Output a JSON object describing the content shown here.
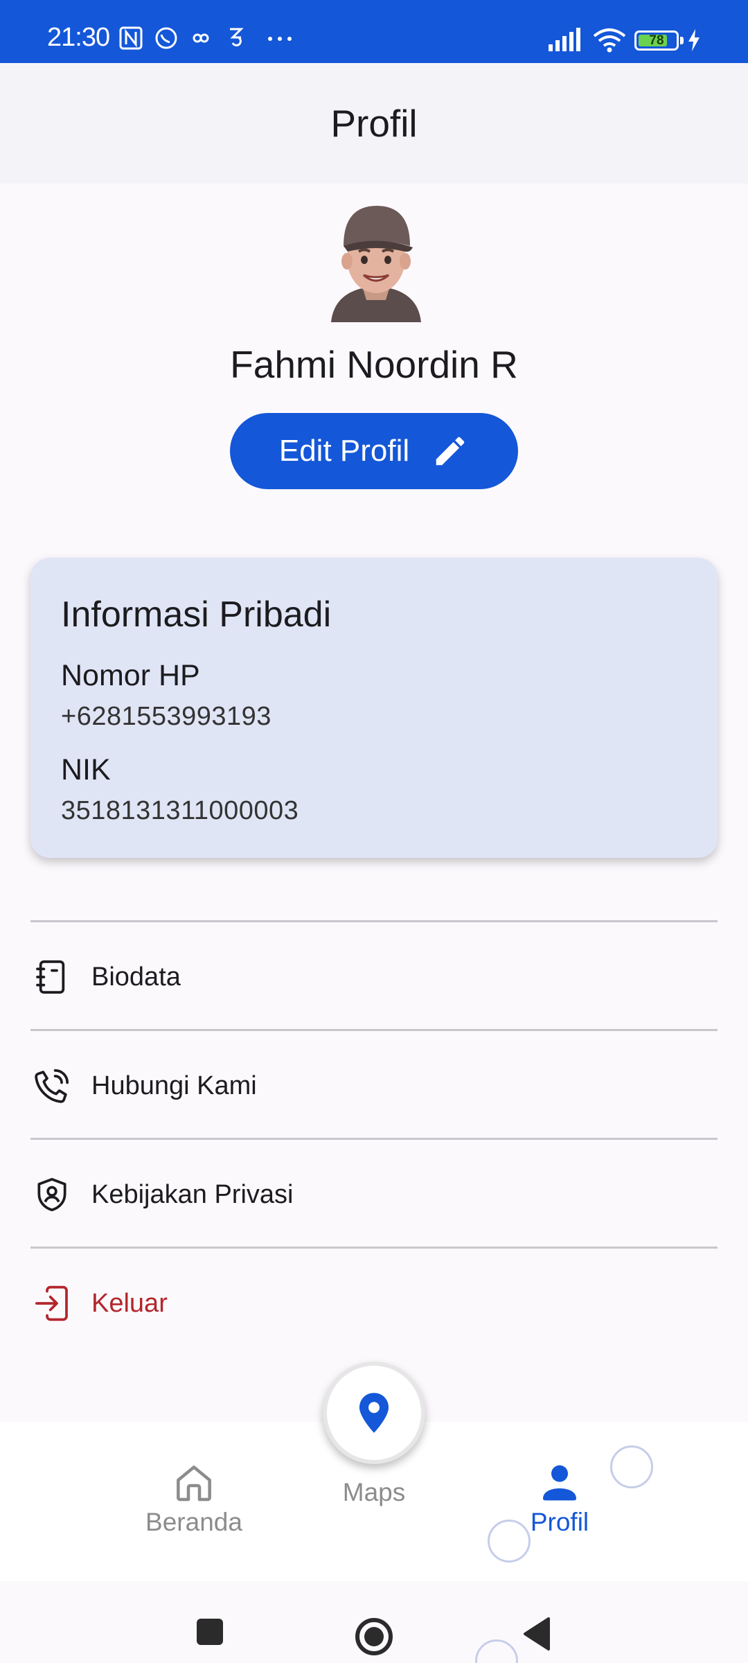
{
  "status_bar": {
    "time": "21:30",
    "battery_level": "78",
    "battery_fraction": 0.78
  },
  "app_bar": {
    "title": "Profil"
  },
  "profile": {
    "name": "Fahmi Noordin R",
    "edit_label": "Edit Profil"
  },
  "personal_info": {
    "title": "Informasi Pribadi",
    "phone_label": "Nomor HP",
    "phone_value": "+6281553993193",
    "nik_label": "NIK",
    "nik_value": "3518131311000003"
  },
  "menu": {
    "items": [
      {
        "label": "Biodata",
        "icon": "notebook-icon"
      },
      {
        "label": "Hubungi Kami",
        "icon": "phone-call-icon"
      },
      {
        "label": "Kebijakan Privasi",
        "icon": "shield-user-icon"
      },
      {
        "label": "Keluar",
        "icon": "logout-icon"
      }
    ]
  },
  "bottom_nav": {
    "items": [
      {
        "label": "Beranda",
        "icon": "home-icon",
        "active": false
      },
      {
        "label": "Maps",
        "icon": "location-pin-icon",
        "active": false
      },
      {
        "label": "Profil",
        "icon": "person-icon",
        "active": true
      }
    ]
  },
  "colors": {
    "primary": "#1457d8",
    "card_bg": "#e0e5f6",
    "danger": "#b3262c",
    "nav_inactive": "#8c8c8c"
  }
}
